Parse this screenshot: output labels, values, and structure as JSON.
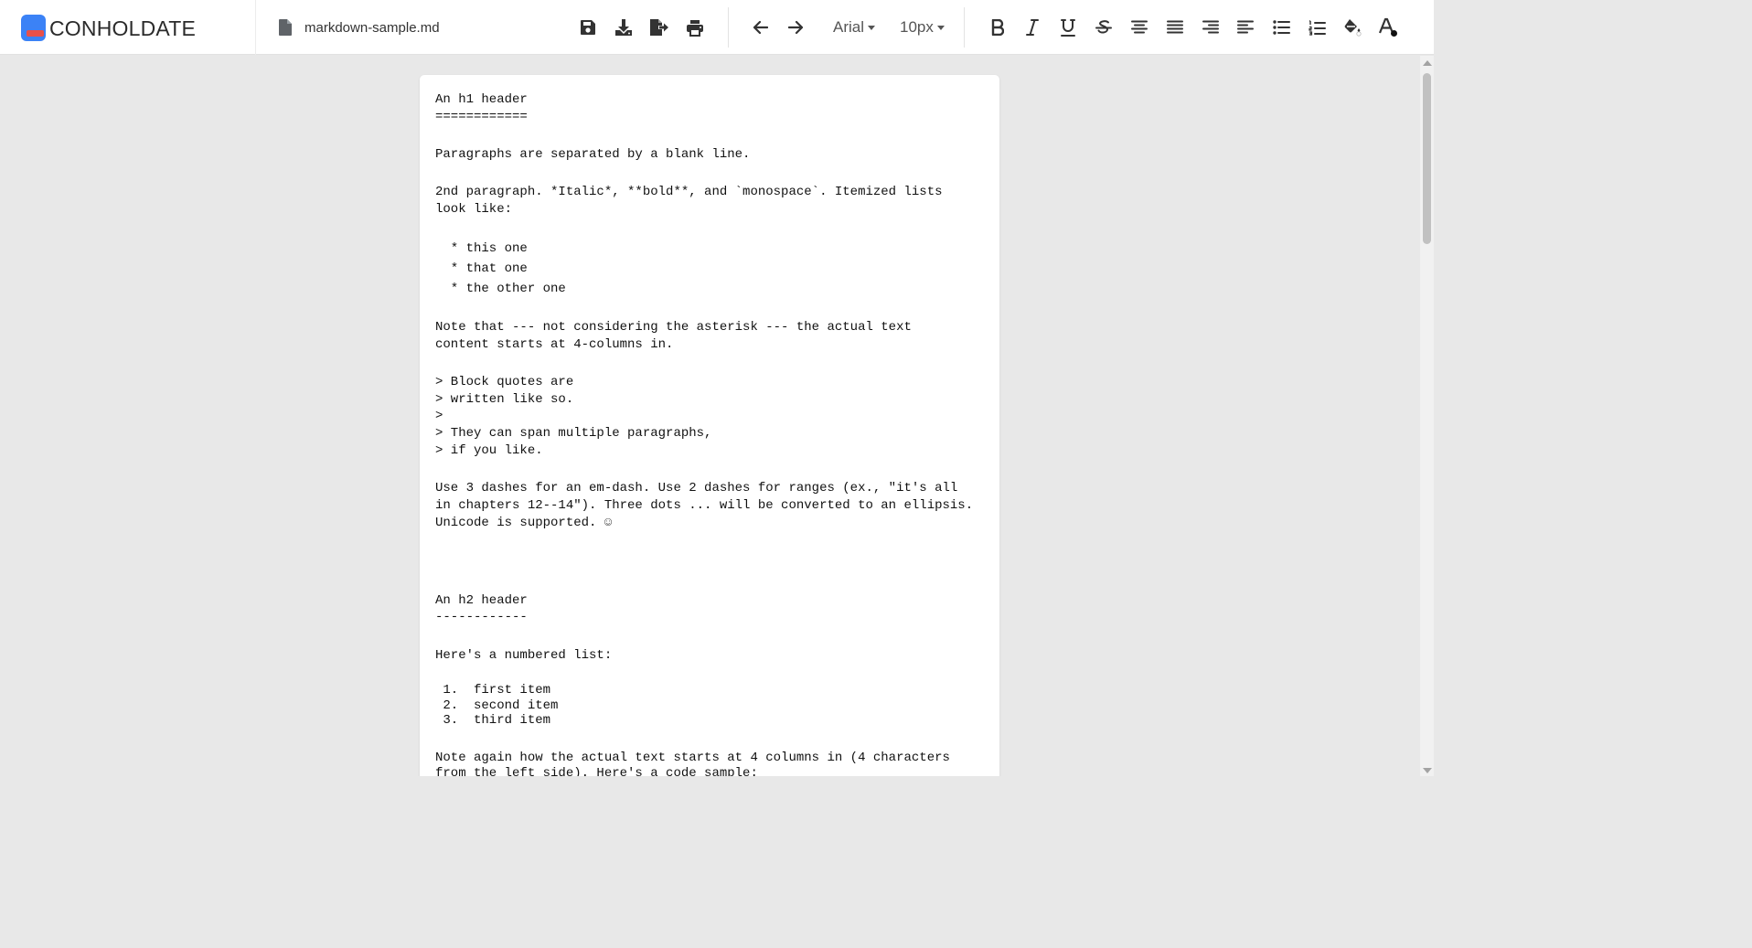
{
  "brand": {
    "name": "CONHOLDATE",
    "accent": "#3b82f6",
    "accent_secondary": "#e8504a"
  },
  "file": {
    "name": "markdown-sample.md",
    "icon": "file-icon"
  },
  "toolbar": {
    "font_family": "Arial",
    "font_size": "10px",
    "buttons": [
      "save-icon",
      "download-icon",
      "export-icon",
      "print-icon",
      "undo-icon",
      "redo-icon",
      "bold-icon",
      "italic-icon",
      "underline-icon",
      "strikethrough-icon",
      "align-center-icon",
      "align-justify-icon",
      "align-right-icon",
      "align-left-icon",
      "bulleted-list-icon",
      "numbered-list-icon",
      "fill-color-icon",
      "text-color-icon"
    ]
  },
  "document": {
    "lines": [
      "An h1 header",
      "============",
      "Paragraphs are separated by a blank line.",
      "2nd paragraph. *Italic*, **bold**, and `monospace`. Itemized lists",
      "look like:",
      "  * this one",
      "  * that one",
      "  * the other one",
      "Note that --- not considering the asterisk --- the actual text",
      "content starts at 4-columns in.",
      "> Block quotes are",
      "> written like so.",
      ">",
      "> They can span multiple paragraphs,",
      "> if you like.",
      "Use 3 dashes for an em-dash. Use 2 dashes for ranges (ex., \"it's all",
      "in chapters 12--14\"). Three dots ... will be converted to an ellipsis.",
      "Unicode is supported. ☺",
      "An h2 header",
      "------------",
      "Here's a numbered list:",
      " 1.  first item",
      " 2.  second item",
      " 3.  third item",
      "Note again how the actual text starts at 4 columns in (4 characters",
      "from the left side). Here's a code sample:"
    ]
  }
}
